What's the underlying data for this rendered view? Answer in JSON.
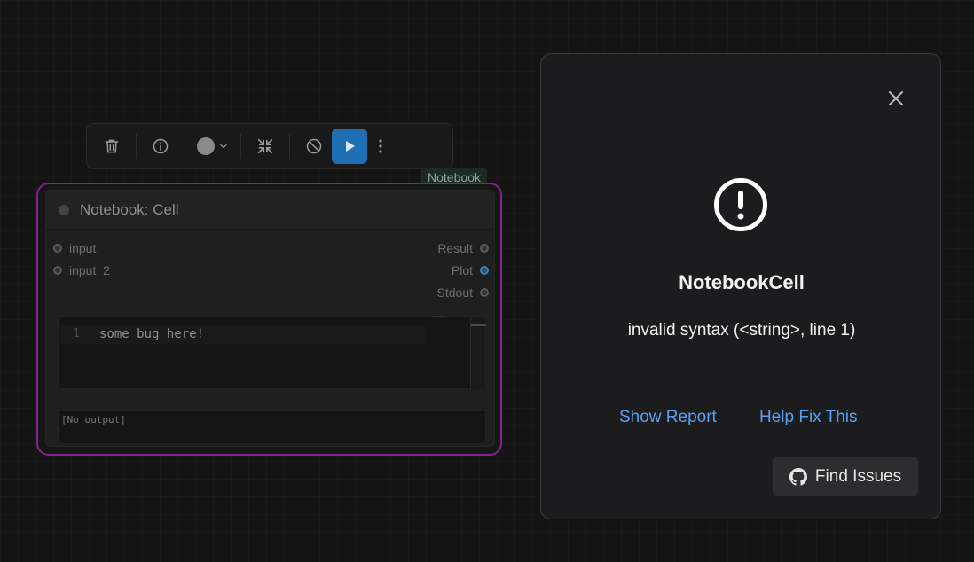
{
  "toolbar": {
    "buttons": [
      "trash-icon",
      "info-icon",
      "color-picker",
      "collapse-icon",
      "bypass-icon",
      "run-icon",
      "more-icon"
    ],
    "color_value": "#8a8a8a"
  },
  "node": {
    "badge": "Notebook",
    "title": "Notebook: Cell",
    "inputs": [
      "input",
      "input_2"
    ],
    "outputs": [
      "Result",
      "Plot",
      "Stdout"
    ],
    "editor": {
      "line_number": "1",
      "code": "some bug here!"
    },
    "output_text": "[No output]",
    "border_color": "#8a1f8e"
  },
  "dialog": {
    "title": "NotebookCell",
    "message": "invalid syntax (<string>, line 1)",
    "show_report": "Show Report",
    "help_fix": "Help Fix This",
    "find_issues": "Find Issues",
    "link_color": "#5aa0f2"
  }
}
